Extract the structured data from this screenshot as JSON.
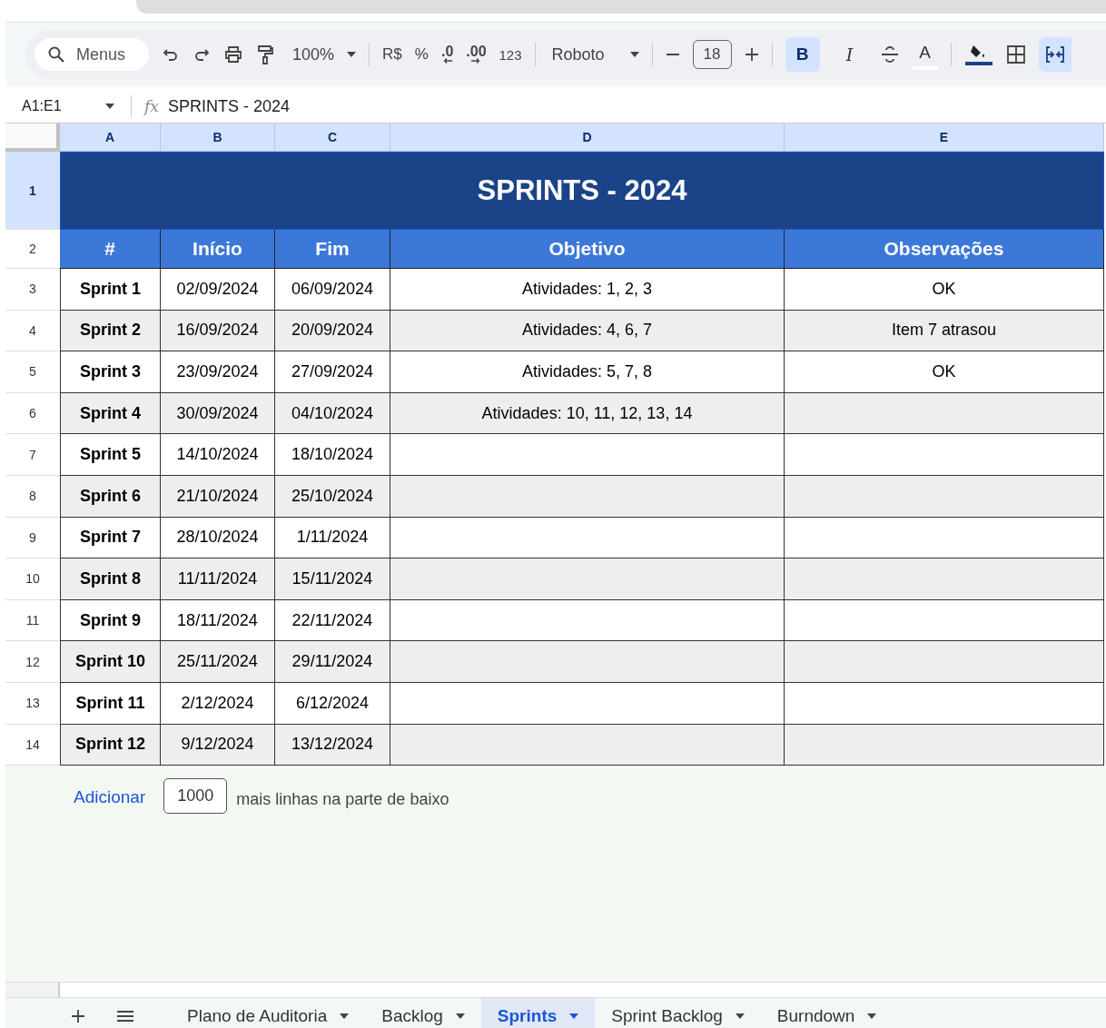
{
  "toolbar": {
    "search_placeholder": "Menus",
    "zoom": "100%",
    "currency": "R$",
    "percent": "%",
    "decrease_decimals": ".0",
    "increase_decimals": ".00",
    "more_formats": "123",
    "font": "Roboto",
    "font_size": "18",
    "bold": "B",
    "bold_on": true,
    "italic": "I",
    "text_color": "A",
    "merge_on": true
  },
  "formula_bar": {
    "cell_ref": "A1:E1",
    "fx": "fx",
    "formula": "SPRINTS - 2024"
  },
  "columns": [
    "A",
    "B",
    "C",
    "D",
    "E"
  ],
  "row_numbers": [
    "1",
    "2",
    "3",
    "4",
    "5",
    "6",
    "7",
    "8",
    "9",
    "10",
    "11",
    "12",
    "13",
    "14"
  ],
  "title": "SPRINTS - 2024",
  "headers": [
    "#",
    "Início",
    "Fim",
    "Objetivo",
    "Observações"
  ],
  "rows": [
    {
      "sprint": "Sprint 1",
      "start": "02/09/2024",
      "end": "06/09/2024",
      "objective": "Atividades: 1, 2, 3",
      "notes": "OK"
    },
    {
      "sprint": "Sprint 2",
      "start": "16/09/2024",
      "end": "20/09/2024",
      "objective": "Atividades: 4, 6, 7",
      "notes": "Item 7 atrasou"
    },
    {
      "sprint": "Sprint 3",
      "start": "23/09/2024",
      "end": "27/09/2024",
      "objective": "Atividades: 5, 7, 8",
      "notes": "OK"
    },
    {
      "sprint": "Sprint 4",
      "start": "30/09/2024",
      "end": "04/10/2024",
      "objective": "Atividades: 10, 11, 12, 13, 14"
    },
    {
      "sprint": "Sprint 5",
      "start": "14/10/2024",
      "end": "18/10/2024"
    },
    {
      "sprint": "Sprint 6",
      "start": "21/10/2024",
      "end": "25/10/2024"
    },
    {
      "sprint": "Sprint 7",
      "start": "28/10/2024",
      "end": "1/11/2024"
    },
    {
      "sprint": "Sprint 8",
      "start": "11/11/2024",
      "end": "15/11/2024"
    },
    {
      "sprint": "Sprint 9",
      "start": "18/11/2024",
      "end": "22/11/2024"
    },
    {
      "sprint": "Sprint 10",
      "start": "25/11/2024",
      "end": "29/11/2024"
    },
    {
      "sprint": "Sprint 11",
      "start": "2/12/2024",
      "end": "6/12/2024"
    },
    {
      "sprint": "Sprint 12",
      "start": "9/12/2024",
      "end": "13/12/2024"
    }
  ],
  "add_rows": {
    "button": "Adicionar",
    "count": "1000",
    "suffix": "mais linhas na parte de baixo"
  },
  "sheet_tabs": [
    {
      "label": "Plano de Auditoria",
      "selected": false
    },
    {
      "label": "Backlog",
      "selected": false
    },
    {
      "label": "Sprints",
      "selected": true
    },
    {
      "label": "Sprint Backlog",
      "selected": false
    },
    {
      "label": "Burndown",
      "selected": false
    }
  ]
}
